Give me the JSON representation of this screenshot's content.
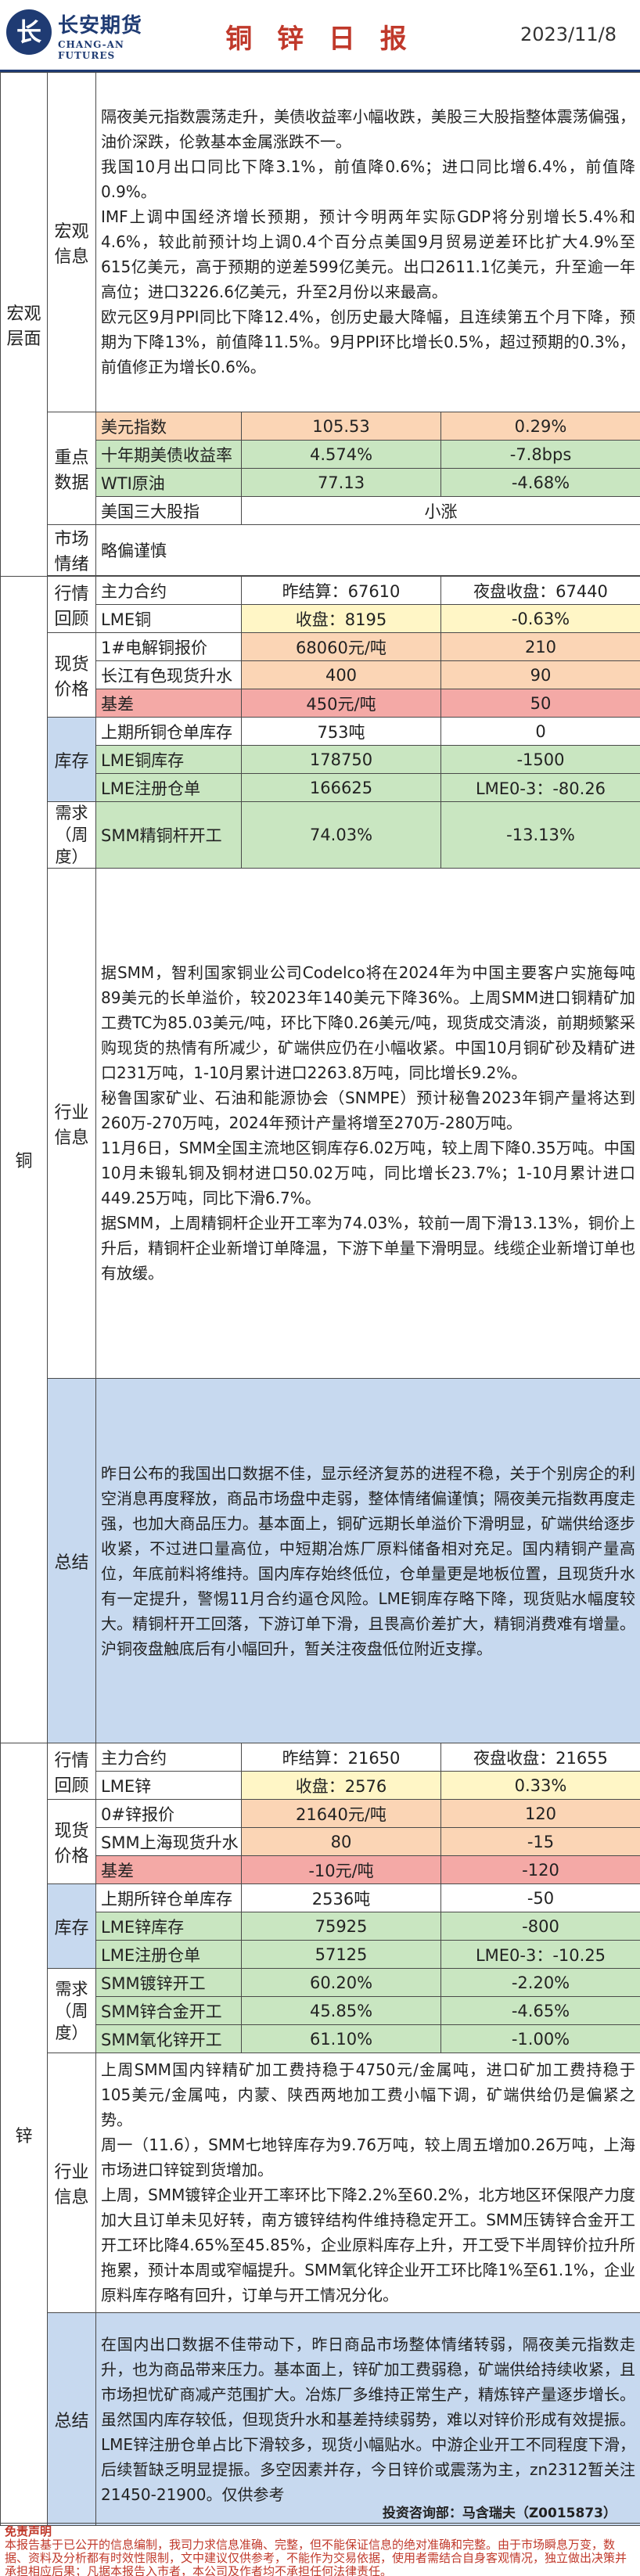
{
  "header": {
    "logo_cn": "长安期货",
    "logo_en": "CHANG-AN FUTURES",
    "title": "铜 锌 日 报",
    "date": "2023/11/8"
  },
  "macro": {
    "section": "宏观层面",
    "info_label": "宏观信息",
    "info_paragraphs": [
      "隔夜美元指数震荡走升，美债收益率小幅收跌，美股三大股指整体震荡偏强，油价深跌，伦敦基本金属涨跌不一。",
      "我国10月出口同比下降3.1%，前值降0.6%；进口同比增6.4%，前值降0.9%。",
      "IMF上调中国经济增长预期，预计今明两年实际GDP将分别增长5.4%和4.6%，较此前预计均上调0.4个百分点美国9月贸易逆差环比扩大4.9%至615亿美元，高于预期的逆差599亿美元。出口2611.1亿美元，升至逾一年高位；进口3226.6亿美元，升至2月份以来最高。",
      "欧元区9月PPI同比下降12.4%，创历史最大降幅，且连续第五个月下降，预期为下降13%，前值降11.5%。9月PPI环比增长0.5%，超过预期的0.3%，前值修正为增长0.6%。"
    ],
    "key_label": "重点数据",
    "key_rows": [
      {
        "name": "美元指数",
        "v1": "105.53",
        "v2": "0.29%"
      },
      {
        "name": "十年期美债收益率",
        "v1": "4.574%",
        "v2": "-7.8bps"
      },
      {
        "name": "WTI原油",
        "v1": "77.13",
        "v2": "-4.68%"
      },
      {
        "name": "美国三大股指",
        "v1": "小涨"
      }
    ],
    "sentiment_label": "市场情绪",
    "sentiment_value": "略偏谨慎"
  },
  "copper": {
    "section": "铜",
    "review_label": "行情回顾",
    "review_rows": [
      {
        "name": "主力合约",
        "v1": "昨结算：67610",
        "v2": "夜盘收盘：67440"
      },
      {
        "name": "LME铜",
        "v1": "收盘：8195",
        "v2": "-0.63%"
      }
    ],
    "spot_label": "现货价格",
    "spot_rows": [
      {
        "name": "1#电解铜报价",
        "v1": "68060元/吨",
        "v2": "210"
      },
      {
        "name": "长江有色现货升水",
        "v1": "400",
        "v2": "90"
      },
      {
        "name": "基差",
        "v1": "450元/吨",
        "v2": "50"
      }
    ],
    "stock_label": "库存",
    "stock_rows": [
      {
        "name": "上期所铜仓单库存",
        "v1": "753吨",
        "v2": "0"
      },
      {
        "name": "LME铜库存",
        "v1": "178750",
        "v2": "-1500"
      },
      {
        "name": "LME注册仓单",
        "v1": "166625",
        "v2": "LME0-3：-80.26"
      }
    ],
    "demand_label": "需求（周度）",
    "demand_rows": [
      {
        "name": "SMM精铜杆开工",
        "v1": "74.03%",
        "v2": "-13.13%"
      }
    ],
    "industry_label": "行业信息",
    "industry_paragraphs": [
      "据SMM，智利国家铜业公司Codelco将在2024年为中国主要客户实施每吨89美元的长单溢价，较2023年140美元下降36%。上周SMM进口铜精矿加工费TC为85.03美元/吨，环比下降0.26美元/吨，现货成交清淡，前期频繁采购现货的热情有所减少，矿端供应仍在小幅收紧。中国10月铜矿砂及精矿进口231万吨，1-10月累计进口2263.8万吨，同比增长9.2%。",
      "秘鲁国家矿业、石油和能源协会（SNMPE）预计秘鲁2023年铜产量将达到260万-270万吨，2024年预计产量将增至270万-280万吨。",
      "11月6日，SMM全国主流地区铜库存6.02万吨，较上周下降0.35万吨。中国10月未锻轧铜及铜材进口50.02万吨，同比增长23.7%；1-10月累计进口449.25万吨，同比下滑6.7%。",
      "据SMM，上周精铜杆企业开工率为74.03%，较前一周下滑13.13%，铜价上升后，精铜杆企业新增订单降温，下游下单量下滑明显。线缆企业新增订单也有放缓。"
    ],
    "summary_label": "总结",
    "summary_text": "昨日公布的我国出口数据不佳，显示经济复苏的进程不稳，关于个别房企的利空消息再度释放，商品市场盘中走弱，整体情绪偏谨慎；隔夜美元指数再度走强，也加大商品压力。基本面上，铜矿远期长单溢价下滑明显，矿端供给逐步收紧，不过进口量高位，中短期冶炼厂原料储备相对充足。国内精铜产量高位，年底前料将维持。国内库存始终低位，仓单量更是地板位置，且现货升水有一定提升，警惕11月合约逼仓风险。LME铜库存略下降，现货贴水幅度较大。精铜杆开工回落，下游订单下滑，且畏高价差扩大，精铜消费难有增量。沪铜夜盘触底后有小幅回升，暂关注夜盘低位附近支撑。"
  },
  "zinc": {
    "section": "锌",
    "review_label": "行情回顾",
    "review_rows": [
      {
        "name": "主力合约",
        "v1": "昨结算：21650",
        "v2": "夜盘收盘：21655"
      },
      {
        "name": "LME锌",
        "v1": "收盘：2576",
        "v2": "0.33%"
      }
    ],
    "spot_label": "现货价格",
    "spot_rows": [
      {
        "name": "0#锌报价",
        "v1": "21640元/吨",
        "v2": "120"
      },
      {
        "name": "SMM上海现货升水",
        "v1": "80",
        "v2": "-15"
      },
      {
        "name": "基差",
        "v1": "-10元/吨",
        "v2": "-120"
      }
    ],
    "stock_label": "库存",
    "stock_rows": [
      {
        "name": "上期所锌仓单库存",
        "v1": "2536吨",
        "v2": "-50"
      },
      {
        "name": "LME锌库存",
        "v1": "75925",
        "v2": "-800"
      },
      {
        "name": "LME注册仓单",
        "v1": "57125",
        "v2": "LME0-3：-10.25"
      }
    ],
    "demand_label": "需求（周度）",
    "demand_rows": [
      {
        "name": "SMM镀锌开工",
        "v1": "60.20%",
        "v2": "-2.20%"
      },
      {
        "name": "SMM锌合金开工",
        "v1": "45.85%",
        "v2": "-4.65%"
      },
      {
        "name": "SMM氧化锌开工",
        "v1": "61.10%",
        "v2": "-1.00%"
      }
    ],
    "industry_label": "行业信息",
    "industry_paragraphs": [
      "上周SMM国内锌精矿加工费持稳于4750元/金属吨，进口矿加工费持稳于105美元/金属吨，内蒙、陕西两地加工费小幅下调，矿端供给仍是偏紧之势。",
      "周一（11.6），SMM七地锌库存为9.76万吨，较上周五增加0.26万吨，上海市场进口锌锭到货增加。",
      "上周，SMM镀锌企业开工率环比下降2.2%至60.2%，北方地区环保限产力度加大且订单未见好转，南方镀锌结构件维持稳定开工。SMM压铸锌合金开工开工环比降4.65%至45.85%，企业原料库存上升，开工受下半周锌价拉升所拖累，预计本周或窄幅提升。SMM氧化锌企业开工环比降1%至61.1%，企业原料库存略有回升，订单与开工情况分化。"
    ],
    "summary_label": "总结",
    "summary_text": "在国内出口数据不佳带动下，昨日商品市场整体情绪转弱，隔夜美元指数走升，也为商品带来压力。基本面上，锌矿加工费弱稳，矿端供给持续收紧，且市场担忧矿商减产范围扩大。冶炼厂多维持正常生产，精炼锌产量逐步增长。虽然国内库存较低，但现货升水和基差持续弱势，难以对锌价形成有效提振。LME锌注册仓单占比下滑较多，现货小幅贴水。中游企业开工不同程度下滑，后续暂缺乏明显提振。多空因素并存，今日锌价或震荡为主，zn2312暂关注21450-21900。仅供参考"
  },
  "footer": {
    "analyst": "投资咨询部：马含瑞夫（Z0015873）",
    "disclaimer_title": "免责声明",
    "disclaimer_text": "本报告基于已公开的信息编制，我司力求信息准确、完整，但不能保证信息的绝对准确和完整。由于市场瞬息万变，数据、资料及分析都有时效性限制，文中建议仅供参考，不能作为交易依据，使用者需结合自身客观情况，独立做出决策并承担相应后果；凡据本报告入市者，本公司及作者均不承担任何法律责任。"
  }
}
